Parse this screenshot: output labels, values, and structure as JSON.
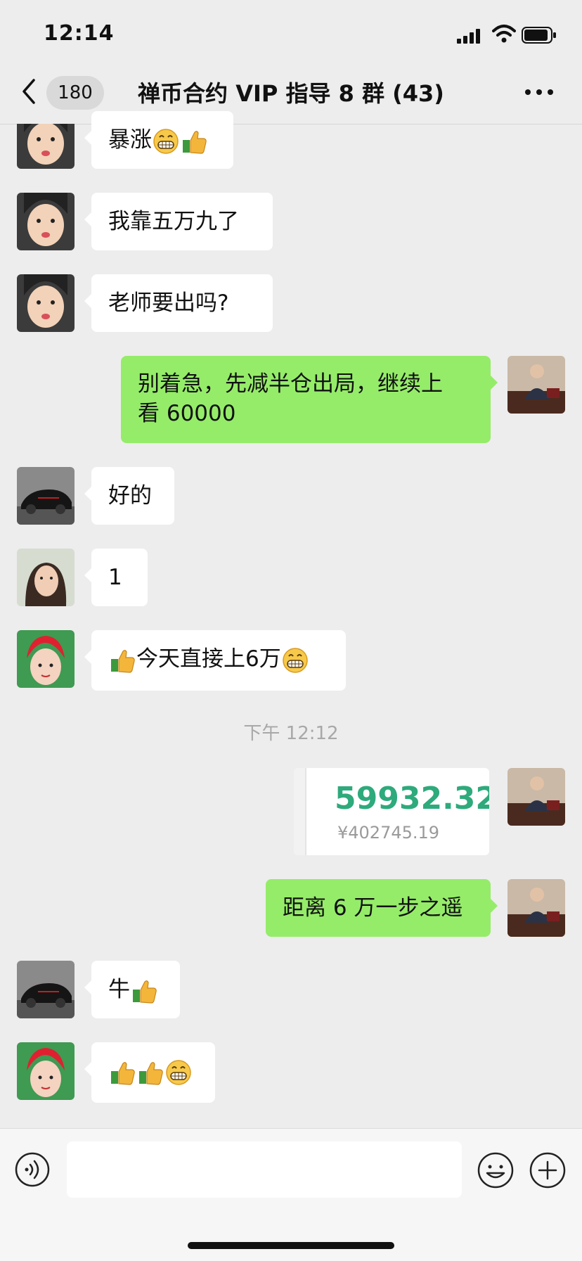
{
  "status_bar": {
    "time": "12:14"
  },
  "nav": {
    "back_count": "180",
    "title": "禅币合约 VIP 指导 8 群 (43)"
  },
  "messages": [
    {
      "side": "in",
      "text": "暴涨",
      "avatar": "girl-face-avatar",
      "emojis_after": [
        "grin-emoji",
        "thumbs-up-emoji"
      ]
    },
    {
      "side": "in",
      "text": "我靠五万九了",
      "avatar": "girl-face-avatar"
    },
    {
      "side": "in",
      "text": "老师要出吗?",
      "avatar": "girl-face-avatar"
    },
    {
      "side": "out",
      "line1": "别着急，先减半仓出局，继续上",
      "line2": "看 60000",
      "avatar": "man-in-suit-avatar"
    },
    {
      "side": "in",
      "text": "好的",
      "avatar": "black-supercar-avatar"
    },
    {
      "side": "in",
      "text": "1",
      "avatar": "woman-portrait-avatar"
    },
    {
      "side": "in",
      "text": "今天直接上6万",
      "avatar": "red-hair-avatar",
      "emojis_before": [
        "thumbs-up-emoji"
      ],
      "emojis_after": [
        "grin-emoji"
      ]
    },
    {
      "side": "out",
      "type": "image",
      "price": "59932.32",
      "subprice": "¥402745.19",
      "avatar": "man-in-suit-avatar"
    },
    {
      "side": "out",
      "text": "距离 6 万一步之遥",
      "avatar": "man-in-suit-avatar"
    },
    {
      "side": "in",
      "text": "牛",
      "avatar": "black-supercar-avatar",
      "emojis_after": [
        "thumbs-up-emoji"
      ]
    },
    {
      "side": "in",
      "text": "",
      "avatar": "red-hair-avatar",
      "emojis_after": [
        "thumbs-up-emoji",
        "thumbs-up-emoji",
        "grin-emoji"
      ]
    }
  ],
  "timestamp": "下午 12:12",
  "colors": {
    "sent_bubble": "#95ec69",
    "received_bubble": "#ffffff",
    "background": "#ededed",
    "price_green": "#2eaa7c"
  },
  "input_bar": {
    "icons": [
      "voice-icon",
      "emoji-icon",
      "plus-icon"
    ]
  }
}
